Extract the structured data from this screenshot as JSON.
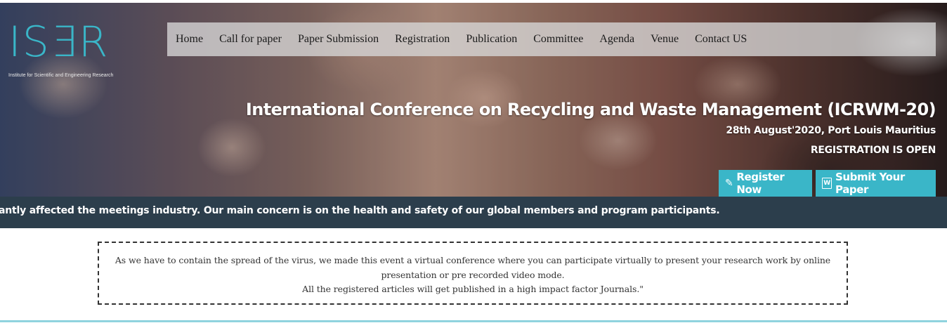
{
  "logo": {
    "mark": "ISER",
    "tagline": "Institute for Scientific and Engineering Research"
  },
  "nav": {
    "items": [
      "Home",
      "Call for paper",
      "Paper Submission",
      "Registration",
      "Publication",
      "Committee",
      "Agenda",
      "Venue",
      "Contact US"
    ]
  },
  "hero": {
    "title": "International Conference on Recycling and Waste Management (ICRWM-20)",
    "date_location": "28th August'2020, Port Louis Mauritius",
    "status": "REGISTRATION IS OPEN",
    "register_label": "Register Now",
    "submit_label": "Submit Your Paper"
  },
  "ticker": {
    "text": "antly affected the meetings industry. Our main concern is on the health and safety of our global members and program participants."
  },
  "notice": {
    "line1": "As we have to contain the spread of the virus, we made this event a virtual conference where you can participate virtually to present your research work by online",
    "line2": "presentation or pre recorded video mode.",
    "line3": "All the registered articles will get published in a high impact factor Journals.\""
  },
  "colors": {
    "accent": "#3ab6c8",
    "ticker_bg": "#2c3e4c"
  },
  "icons": {
    "register": "pencil-icon",
    "submit": "word-document-icon"
  }
}
